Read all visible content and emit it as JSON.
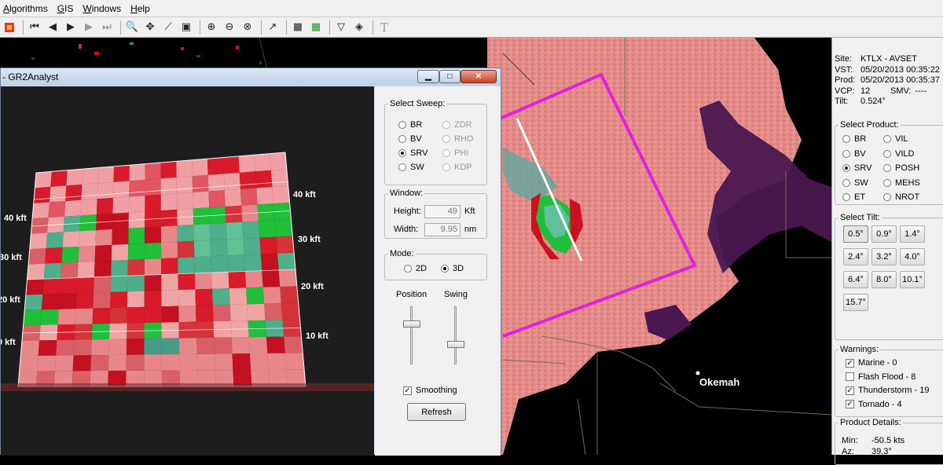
{
  "menu": {
    "items": [
      "Algorithms",
      "GIS",
      "Windows",
      "Help"
    ]
  },
  "map": {
    "city_label": "Okemah"
  },
  "panel": {
    "site_label": "Site:",
    "site": "KTLX - AVSET",
    "vst_label": "VST:",
    "vst": "05/20/2013 00:35:22",
    "prod_label": "Prod:",
    "prod": "05/20/2013 00:35:37",
    "vcp_label": "VCP:",
    "vcp": "12",
    "smv_label": "SMV:",
    "smv": "----",
    "tilt_label": "Tilt:",
    "tilt": "0.524°",
    "select_product_title": "Select Product:",
    "products": [
      {
        "label": "BR",
        "selected": false
      },
      {
        "label": "VIL",
        "selected": false
      },
      {
        "label": "BV",
        "selected": false
      },
      {
        "label": "VILD",
        "selected": false
      },
      {
        "label": "SRV",
        "selected": true
      },
      {
        "label": "POSH",
        "selected": false
      },
      {
        "label": "SW",
        "selected": false
      },
      {
        "label": "MEHS",
        "selected": false
      },
      {
        "label": "ET",
        "selected": false
      },
      {
        "label": "NROT",
        "selected": false
      }
    ],
    "select_tilt_title": "Select Tilt:",
    "tilts": [
      "0.5°",
      "0.9°",
      "1.4°",
      "2.4°",
      "3.2°",
      "4.0°",
      "6.4°",
      "8.0°",
      "10.1°",
      "15.7°"
    ],
    "selected_tilt": "0.5°",
    "warnings_title": "Warnings:",
    "warnings": [
      {
        "label": "Marine - 0",
        "checked": true
      },
      {
        "label": "Flash Flood - 8",
        "checked": false
      },
      {
        "label": "Thunderstorm - 19",
        "checked": true
      },
      {
        "label": "Tornado - 4",
        "checked": true
      }
    ],
    "product_details_title": "Product Details:",
    "min_label": "Min:",
    "min": "-50.5 kts",
    "az_label": "Az:",
    "az": "39.3°"
  },
  "window": {
    "title": "- GR2Analyst",
    "altitude_labels_right": [
      "40 kft",
      "30 kft",
      "20 kft",
      "10 kft"
    ],
    "altitude_labels_left": [
      "40 kft",
      "30 kft",
      "20 kft",
      "0 kft"
    ],
    "select_sweep_title": "Select Sweep:",
    "sweeps": [
      {
        "label": "BR",
        "selected": false,
        "enabled": true
      },
      {
        "label": "ZDR",
        "selected": false,
        "enabled": false
      },
      {
        "label": "BV",
        "selected": false,
        "enabled": true
      },
      {
        "label": "RHO",
        "selected": false,
        "enabled": false
      },
      {
        "label": "SRV",
        "selected": true,
        "enabled": true
      },
      {
        "label": "PHI",
        "selected": false,
        "enabled": false
      },
      {
        "label": "SW",
        "selected": false,
        "enabled": true
      },
      {
        "label": "KDP",
        "selected": false,
        "enabled": false
      }
    ],
    "window_group_title": "Window:",
    "height_label": "Height:",
    "height_value": "49",
    "height_unit": "Kft",
    "width_label": "Width:",
    "width_value": "9.95",
    "width_unit": "nm",
    "mode_title": "Mode:",
    "mode_2d": "2D",
    "mode_3d": "3D",
    "mode_selected": "3D",
    "position_label": "Position",
    "swing_label": "Swing",
    "position_fraction": 0.3,
    "swing_fraction": 0.65,
    "smoothing_label": "Smoothing",
    "smoothing_checked": true,
    "refresh_label": "Refresh"
  },
  "colors": {
    "reflectivity_pink": "#e88a8a",
    "warning_box": "#e020e0",
    "purple": "#5a2060",
    "green": "#1fbf3a",
    "red": "#cc1020"
  }
}
